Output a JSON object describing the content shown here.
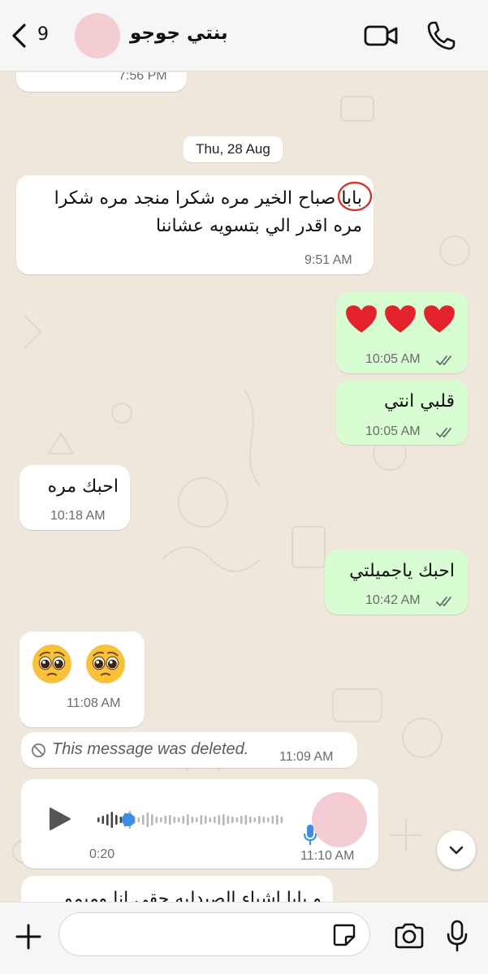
{
  "header": {
    "unread_count": "9",
    "contact_name": "بنتي جوجو"
  },
  "messages": {
    "m0_time": "7:56 PM",
    "date_label": "Thu, 28 Aug",
    "m1_text_line1": "بابا صباح الخير مره شكرا منجد مره شكرا",
    "m1_text_line2": "مره اقدر الي بتسويه عشاننا",
    "m1_time": "9:51 AM",
    "m2_emoji": "❤️❤️❤️",
    "m2_time": "10:05 AM",
    "m3_text": "قلبي انتي",
    "m3_time": "10:05 AM",
    "m4_text": "احبك مره",
    "m4_time": "10:18 AM",
    "m5_text": "احبك ياجميلتي",
    "m5_time": "10:42 AM",
    "m6_emoji": "🥺 🥺",
    "m6_time": "11:08 AM",
    "m7_text": "This message was deleted.",
    "m7_time": "11:09 AM",
    "m8_duration": "0:20",
    "m8_time": "11:10 AM",
    "m9_text": "و بابا اشياء الصيدليه حقي انا وميمو"
  },
  "colors": {
    "incoming": "#ffffff",
    "outgoing": "#d8fdd2",
    "wallpaper": "#efe7dc",
    "tick_read": "#53bdeb",
    "voice_dot": "#3a8ee6",
    "highlight_circle": "#d0362b"
  },
  "icons": {
    "back": "chevron-left-icon",
    "video": "video-camera-icon",
    "phone": "phone-icon",
    "deleted": "prohibited-icon",
    "play": "play-icon",
    "mic": "microphone-icon",
    "scroll": "chevron-down-icon",
    "plus": "plus-icon",
    "sticker": "sticker-icon",
    "camera": "camera-icon"
  }
}
